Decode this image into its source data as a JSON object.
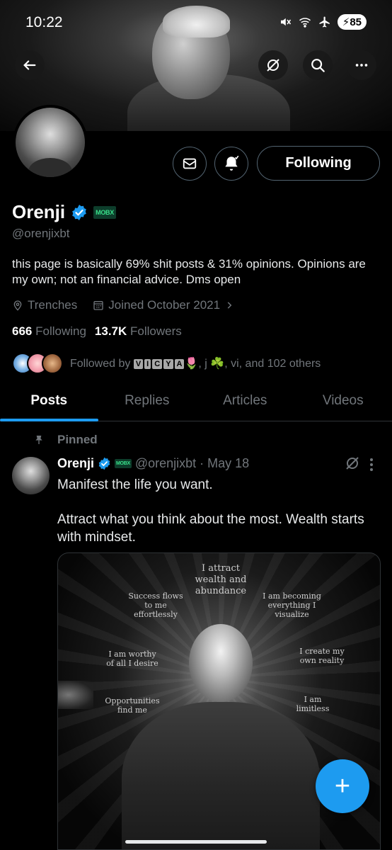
{
  "status_bar": {
    "time": "10:22",
    "battery": "85"
  },
  "profile": {
    "name": "Orenji",
    "badge": "MOBX",
    "handle": "@orenjixbt",
    "bio": "this page is basically 69% shit posts & 31% opinions. Opinions are my own; not an financial advice. Dms open",
    "location": "Trenches",
    "joined": "Joined October 2021",
    "following_count": "666",
    "following_label": "Following",
    "followers_count": "13.7K",
    "followers_label": "Followers",
    "followed_by_prefix": "Followed by",
    "followed_by_vicya": [
      "V",
      "I",
      "C",
      "Y",
      "A"
    ],
    "followed_by_suffix": "🌷, j ☘️, vi, and 102 others",
    "follow_button": "Following"
  },
  "tabs": [
    {
      "label": "Posts",
      "active": true
    },
    {
      "label": "Replies",
      "active": false
    },
    {
      "label": "Articles",
      "active": false
    },
    {
      "label": "Videos",
      "active": false
    }
  ],
  "post": {
    "pinned_label": "Pinned",
    "author": "Orenji",
    "badge": "MOBX",
    "handle": "@orenjixbt",
    "date": "· May 18",
    "line1": "Manifest the life you want.",
    "line2": "Attract what you think about the most. Wealth starts with mindset.",
    "image": {
      "affirmations": {
        "top": "I attract wealth and abundance",
        "left1": "Success flows to me effortlessly",
        "right1": "I am becoming everything I visualize",
        "left2": "I am worthy of all I desire",
        "right2": "I create my own reality",
        "left3": "Opportunities find me",
        "right3": "I am limitless"
      }
    }
  },
  "fab": {
    "label": "+"
  },
  "colors": {
    "accent": "#1d9bf0",
    "muted": "#71767b",
    "border": "#536471",
    "background": "#000000"
  }
}
